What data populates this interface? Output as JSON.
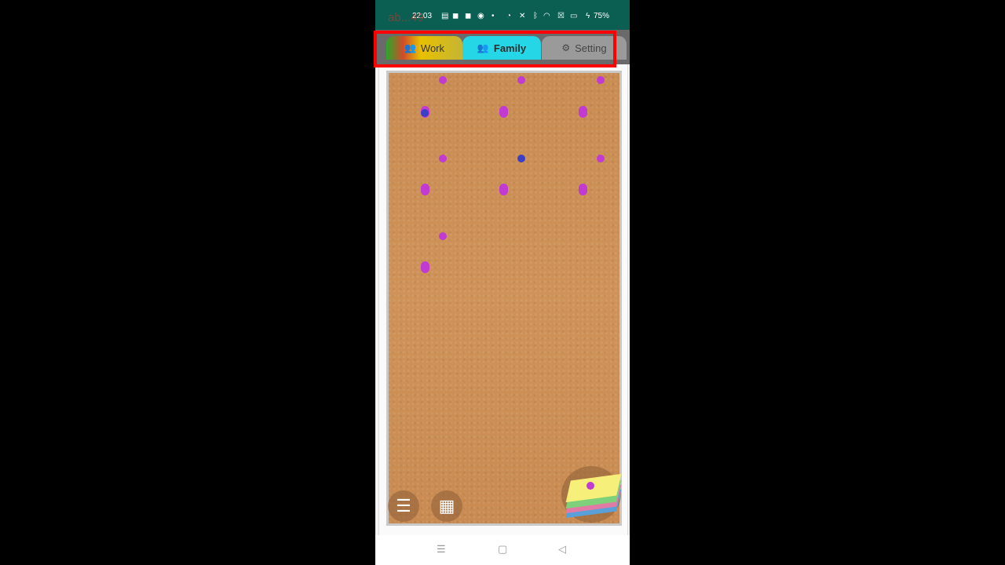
{
  "status_bar": {
    "time": "22:03",
    "battery": "75%",
    "icons": [
      "message-icon",
      "app-icon",
      "app-icon",
      "app-icon",
      "dot",
      "speed-icon",
      "mute-icon",
      "bluetooth-icon",
      "wifi-icon",
      "box-icon",
      "battery-icon",
      "charging-icon"
    ]
  },
  "overlay_text": "ab...49",
  "tabs": [
    {
      "label": "Work",
      "icon": "people-icon",
      "selected": false
    },
    {
      "label": "Family",
      "icon": "people-icon",
      "selected": true
    },
    {
      "label": "Setting",
      "icon": "gear-icon",
      "selected": false
    }
  ],
  "bottom_controls": {
    "menu_glyph": "☰",
    "calendar_glyph": "▦"
  },
  "nav": {
    "recents_glyph": "☰",
    "home_glyph": "▢",
    "back_glyph": "◁"
  },
  "colors": {
    "status_bar": "#0b5e52",
    "family_tab": "#25d6e6",
    "cork": "#cf9359",
    "marker_magenta": "#c13ad2",
    "marker_blue": "#3b3fc4",
    "highlight": "#ff0000"
  }
}
